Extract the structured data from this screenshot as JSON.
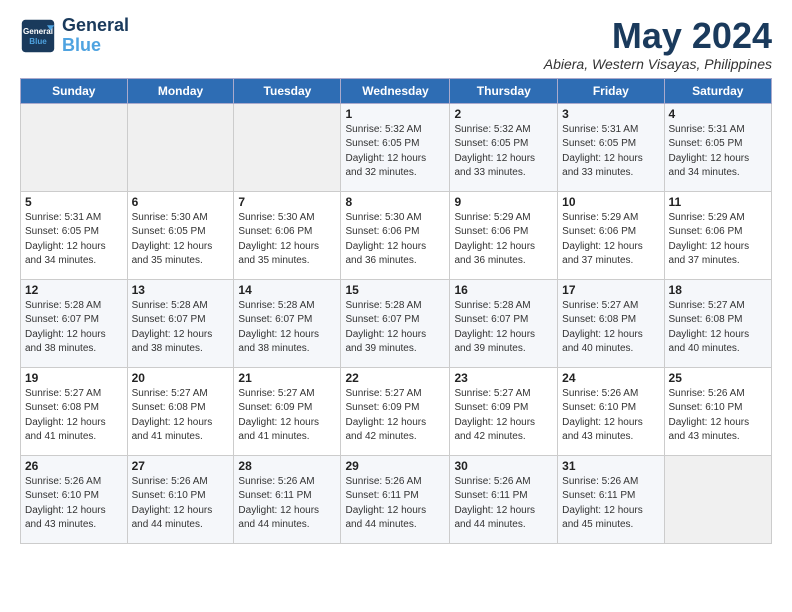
{
  "logo": {
    "line1": "General",
    "line2": "Blue"
  },
  "title": "May 2024",
  "subtitle": "Abiera, Western Visayas, Philippines",
  "days_header": [
    "Sunday",
    "Monday",
    "Tuesday",
    "Wednesday",
    "Thursday",
    "Friday",
    "Saturday"
  ],
  "weeks": [
    [
      {
        "day": "",
        "detail": ""
      },
      {
        "day": "",
        "detail": ""
      },
      {
        "day": "",
        "detail": ""
      },
      {
        "day": "1",
        "detail": "Sunrise: 5:32 AM\nSunset: 6:05 PM\nDaylight: 12 hours\nand 32 minutes."
      },
      {
        "day": "2",
        "detail": "Sunrise: 5:32 AM\nSunset: 6:05 PM\nDaylight: 12 hours\nand 33 minutes."
      },
      {
        "day": "3",
        "detail": "Sunrise: 5:31 AM\nSunset: 6:05 PM\nDaylight: 12 hours\nand 33 minutes."
      },
      {
        "day": "4",
        "detail": "Sunrise: 5:31 AM\nSunset: 6:05 PM\nDaylight: 12 hours\nand 34 minutes."
      }
    ],
    [
      {
        "day": "5",
        "detail": "Sunrise: 5:31 AM\nSunset: 6:05 PM\nDaylight: 12 hours\nand 34 minutes."
      },
      {
        "day": "6",
        "detail": "Sunrise: 5:30 AM\nSunset: 6:05 PM\nDaylight: 12 hours\nand 35 minutes."
      },
      {
        "day": "7",
        "detail": "Sunrise: 5:30 AM\nSunset: 6:06 PM\nDaylight: 12 hours\nand 35 minutes."
      },
      {
        "day": "8",
        "detail": "Sunrise: 5:30 AM\nSunset: 6:06 PM\nDaylight: 12 hours\nand 36 minutes."
      },
      {
        "day": "9",
        "detail": "Sunrise: 5:29 AM\nSunset: 6:06 PM\nDaylight: 12 hours\nand 36 minutes."
      },
      {
        "day": "10",
        "detail": "Sunrise: 5:29 AM\nSunset: 6:06 PM\nDaylight: 12 hours\nand 37 minutes."
      },
      {
        "day": "11",
        "detail": "Sunrise: 5:29 AM\nSunset: 6:06 PM\nDaylight: 12 hours\nand 37 minutes."
      }
    ],
    [
      {
        "day": "12",
        "detail": "Sunrise: 5:28 AM\nSunset: 6:07 PM\nDaylight: 12 hours\nand 38 minutes."
      },
      {
        "day": "13",
        "detail": "Sunrise: 5:28 AM\nSunset: 6:07 PM\nDaylight: 12 hours\nand 38 minutes."
      },
      {
        "day": "14",
        "detail": "Sunrise: 5:28 AM\nSunset: 6:07 PM\nDaylight: 12 hours\nand 38 minutes."
      },
      {
        "day": "15",
        "detail": "Sunrise: 5:28 AM\nSunset: 6:07 PM\nDaylight: 12 hours\nand 39 minutes."
      },
      {
        "day": "16",
        "detail": "Sunrise: 5:28 AM\nSunset: 6:07 PM\nDaylight: 12 hours\nand 39 minutes."
      },
      {
        "day": "17",
        "detail": "Sunrise: 5:27 AM\nSunset: 6:08 PM\nDaylight: 12 hours\nand 40 minutes."
      },
      {
        "day": "18",
        "detail": "Sunrise: 5:27 AM\nSunset: 6:08 PM\nDaylight: 12 hours\nand 40 minutes."
      }
    ],
    [
      {
        "day": "19",
        "detail": "Sunrise: 5:27 AM\nSunset: 6:08 PM\nDaylight: 12 hours\nand 41 minutes."
      },
      {
        "day": "20",
        "detail": "Sunrise: 5:27 AM\nSunset: 6:08 PM\nDaylight: 12 hours\nand 41 minutes."
      },
      {
        "day": "21",
        "detail": "Sunrise: 5:27 AM\nSunset: 6:09 PM\nDaylight: 12 hours\nand 41 minutes."
      },
      {
        "day": "22",
        "detail": "Sunrise: 5:27 AM\nSunset: 6:09 PM\nDaylight: 12 hours\nand 42 minutes."
      },
      {
        "day": "23",
        "detail": "Sunrise: 5:27 AM\nSunset: 6:09 PM\nDaylight: 12 hours\nand 42 minutes."
      },
      {
        "day": "24",
        "detail": "Sunrise: 5:26 AM\nSunset: 6:10 PM\nDaylight: 12 hours\nand 43 minutes."
      },
      {
        "day": "25",
        "detail": "Sunrise: 5:26 AM\nSunset: 6:10 PM\nDaylight: 12 hours\nand 43 minutes."
      }
    ],
    [
      {
        "day": "26",
        "detail": "Sunrise: 5:26 AM\nSunset: 6:10 PM\nDaylight: 12 hours\nand 43 minutes."
      },
      {
        "day": "27",
        "detail": "Sunrise: 5:26 AM\nSunset: 6:10 PM\nDaylight: 12 hours\nand 44 minutes."
      },
      {
        "day": "28",
        "detail": "Sunrise: 5:26 AM\nSunset: 6:11 PM\nDaylight: 12 hours\nand 44 minutes."
      },
      {
        "day": "29",
        "detail": "Sunrise: 5:26 AM\nSunset: 6:11 PM\nDaylight: 12 hours\nand 44 minutes."
      },
      {
        "day": "30",
        "detail": "Sunrise: 5:26 AM\nSunset: 6:11 PM\nDaylight: 12 hours\nand 44 minutes."
      },
      {
        "day": "31",
        "detail": "Sunrise: 5:26 AM\nSunset: 6:11 PM\nDaylight: 12 hours\nand 45 minutes."
      },
      {
        "day": "",
        "detail": ""
      }
    ]
  ]
}
